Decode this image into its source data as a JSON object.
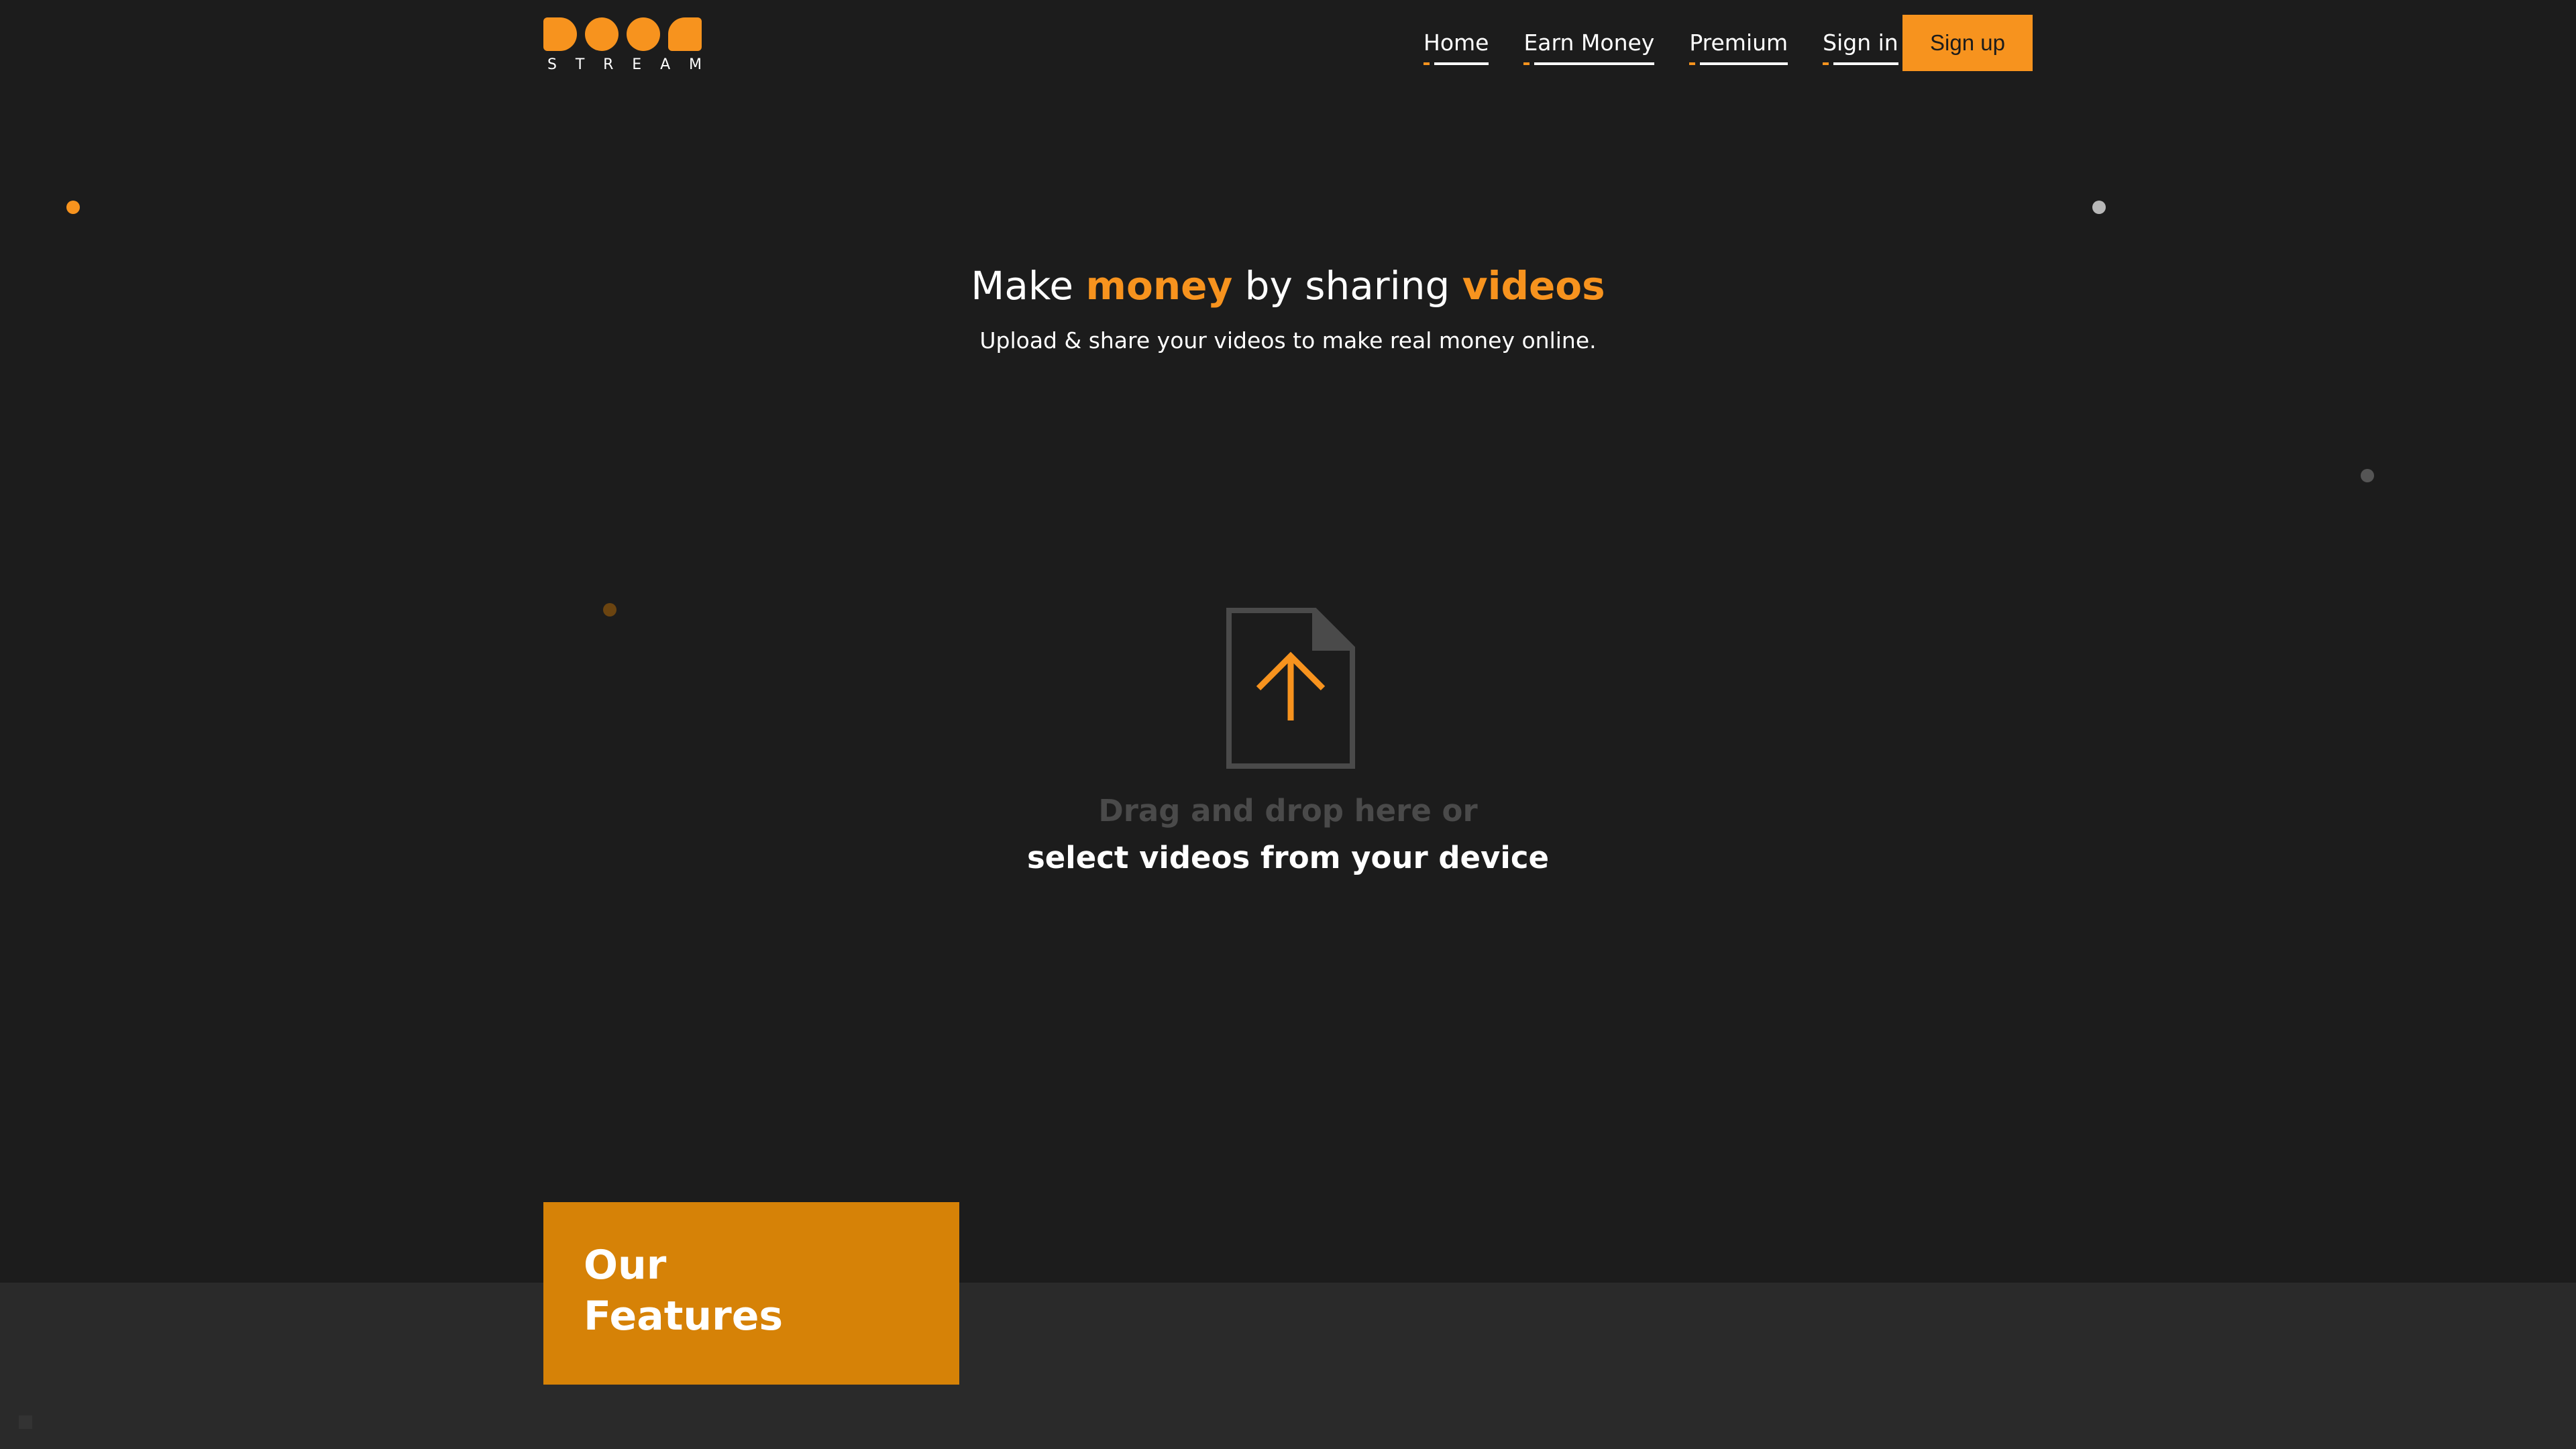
{
  "header": {
    "logo": {
      "icon": "doodstream-logo",
      "wordmark": [
        "S",
        "T",
        "R",
        "E",
        "A",
        "M"
      ]
    },
    "nav": [
      {
        "label": "Home"
      },
      {
        "label": "Earn Money"
      },
      {
        "label": "Premium"
      },
      {
        "label": "Sign in"
      }
    ],
    "signup_label": "Sign up"
  },
  "hero": {
    "title_part1": "Make ",
    "title_highlight1": "money",
    "title_part2": " by sharing ",
    "title_highlight2": "videos",
    "subtitle": "Upload & share your videos to make real money online."
  },
  "upload": {
    "icon": "file-upload-icon",
    "drag_text": "Drag and drop here or",
    "select_text": "select videos from your device"
  },
  "features": {
    "title_line1": "Our",
    "title_line2": "Features"
  },
  "colors": {
    "accent": "#f7931e",
    "background": "#1c1c1c",
    "features_card": "#d68207",
    "band": "#2a2a2a"
  }
}
